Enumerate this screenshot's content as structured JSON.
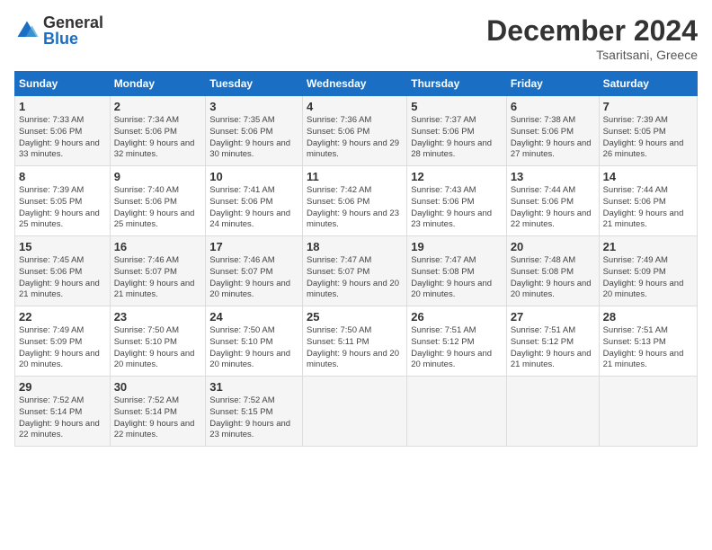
{
  "logo": {
    "general": "General",
    "blue": "Blue"
  },
  "title": "December 2024",
  "location": "Tsaritsani, Greece",
  "weekdays": [
    "Sunday",
    "Monday",
    "Tuesday",
    "Wednesday",
    "Thursday",
    "Friday",
    "Saturday"
  ],
  "weeks": [
    [
      {
        "day": "1",
        "sunrise": "7:33 AM",
        "sunset": "5:06 PM",
        "daylight": "9 hours and 33 minutes."
      },
      {
        "day": "2",
        "sunrise": "7:34 AM",
        "sunset": "5:06 PM",
        "daylight": "9 hours and 32 minutes."
      },
      {
        "day": "3",
        "sunrise": "7:35 AM",
        "sunset": "5:06 PM",
        "daylight": "9 hours and 30 minutes."
      },
      {
        "day": "4",
        "sunrise": "7:36 AM",
        "sunset": "5:06 PM",
        "daylight": "9 hours and 29 minutes."
      },
      {
        "day": "5",
        "sunrise": "7:37 AM",
        "sunset": "5:06 PM",
        "daylight": "9 hours and 28 minutes."
      },
      {
        "day": "6",
        "sunrise": "7:38 AM",
        "sunset": "5:06 PM",
        "daylight": "9 hours and 27 minutes."
      },
      {
        "day": "7",
        "sunrise": "7:39 AM",
        "sunset": "5:05 PM",
        "daylight": "9 hours and 26 minutes."
      }
    ],
    [
      {
        "day": "8",
        "sunrise": "7:39 AM",
        "sunset": "5:05 PM",
        "daylight": "9 hours and 25 minutes."
      },
      {
        "day": "9",
        "sunrise": "7:40 AM",
        "sunset": "5:06 PM",
        "daylight": "9 hours and 25 minutes."
      },
      {
        "day": "10",
        "sunrise": "7:41 AM",
        "sunset": "5:06 PM",
        "daylight": "9 hours and 24 minutes."
      },
      {
        "day": "11",
        "sunrise": "7:42 AM",
        "sunset": "5:06 PM",
        "daylight": "9 hours and 23 minutes."
      },
      {
        "day": "12",
        "sunrise": "7:43 AM",
        "sunset": "5:06 PM",
        "daylight": "9 hours and 23 minutes."
      },
      {
        "day": "13",
        "sunrise": "7:44 AM",
        "sunset": "5:06 PM",
        "daylight": "9 hours and 22 minutes."
      },
      {
        "day": "14",
        "sunrise": "7:44 AM",
        "sunset": "5:06 PM",
        "daylight": "9 hours and 21 minutes."
      }
    ],
    [
      {
        "day": "15",
        "sunrise": "7:45 AM",
        "sunset": "5:06 PM",
        "daylight": "9 hours and 21 minutes."
      },
      {
        "day": "16",
        "sunrise": "7:46 AM",
        "sunset": "5:07 PM",
        "daylight": "9 hours and 21 minutes."
      },
      {
        "day": "17",
        "sunrise": "7:46 AM",
        "sunset": "5:07 PM",
        "daylight": "9 hours and 20 minutes."
      },
      {
        "day": "18",
        "sunrise": "7:47 AM",
        "sunset": "5:07 PM",
        "daylight": "9 hours and 20 minutes."
      },
      {
        "day": "19",
        "sunrise": "7:47 AM",
        "sunset": "5:08 PM",
        "daylight": "9 hours and 20 minutes."
      },
      {
        "day": "20",
        "sunrise": "7:48 AM",
        "sunset": "5:08 PM",
        "daylight": "9 hours and 20 minutes."
      },
      {
        "day": "21",
        "sunrise": "7:49 AM",
        "sunset": "5:09 PM",
        "daylight": "9 hours and 20 minutes."
      }
    ],
    [
      {
        "day": "22",
        "sunrise": "7:49 AM",
        "sunset": "5:09 PM",
        "daylight": "9 hours and 20 minutes."
      },
      {
        "day": "23",
        "sunrise": "7:50 AM",
        "sunset": "5:10 PM",
        "daylight": "9 hours and 20 minutes."
      },
      {
        "day": "24",
        "sunrise": "7:50 AM",
        "sunset": "5:10 PM",
        "daylight": "9 hours and 20 minutes."
      },
      {
        "day": "25",
        "sunrise": "7:50 AM",
        "sunset": "5:11 PM",
        "daylight": "9 hours and 20 minutes."
      },
      {
        "day": "26",
        "sunrise": "7:51 AM",
        "sunset": "5:12 PM",
        "daylight": "9 hours and 20 minutes."
      },
      {
        "day": "27",
        "sunrise": "7:51 AM",
        "sunset": "5:12 PM",
        "daylight": "9 hours and 21 minutes."
      },
      {
        "day": "28",
        "sunrise": "7:51 AM",
        "sunset": "5:13 PM",
        "daylight": "9 hours and 21 minutes."
      }
    ],
    [
      {
        "day": "29",
        "sunrise": "7:52 AM",
        "sunset": "5:14 PM",
        "daylight": "9 hours and 22 minutes."
      },
      {
        "day": "30",
        "sunrise": "7:52 AM",
        "sunset": "5:14 PM",
        "daylight": "9 hours and 22 minutes."
      },
      {
        "day": "31",
        "sunrise": "7:52 AM",
        "sunset": "5:15 PM",
        "daylight": "9 hours and 23 minutes."
      },
      null,
      null,
      null,
      null
    ]
  ]
}
